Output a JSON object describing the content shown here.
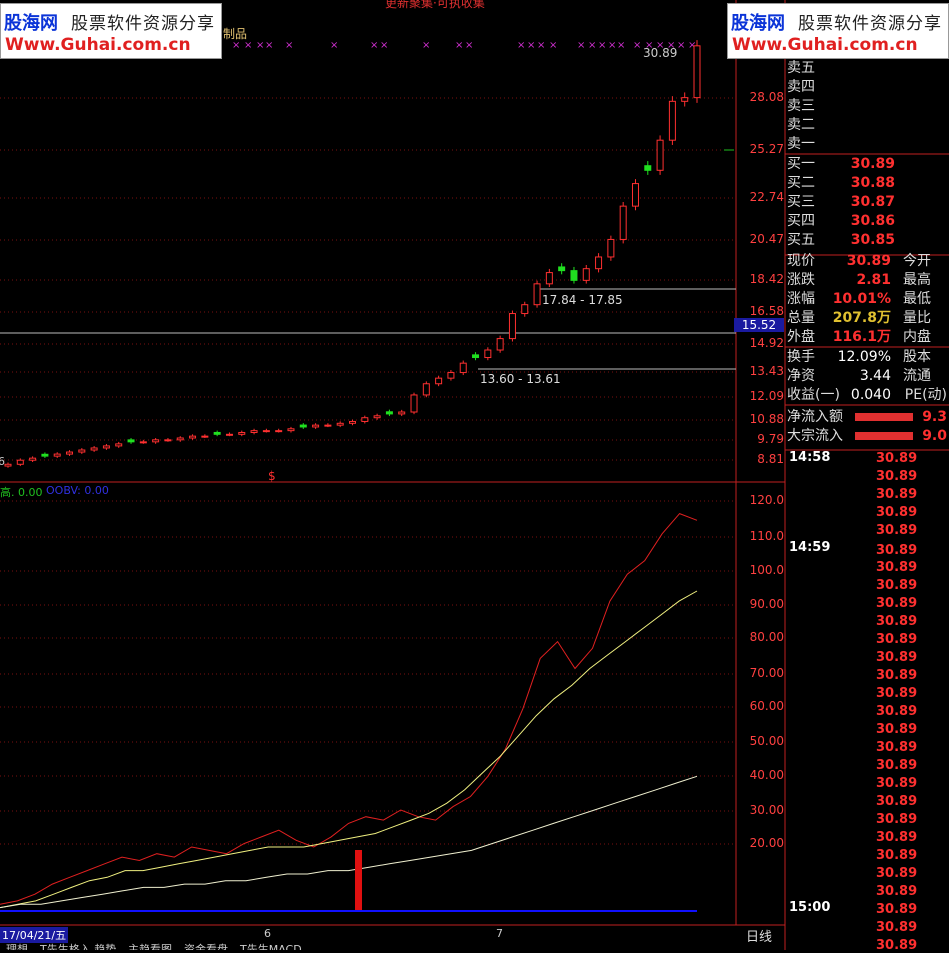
{
  "top_title": "更新聚集·可执收集",
  "watermark": {
    "brand": "股海网",
    "tagline": "股票软件资源分享",
    "url": "Www.Guhai.com.cn"
  },
  "indicator_title_fragment": "制品",
  "price_axis": [
    "28.08",
    "25.27",
    "22.74",
    "20.47",
    "18.42",
    "16.58",
    "14.92",
    "13.43",
    "12.09",
    "10.88",
    "9.79",
    "8.81"
  ],
  "current_price_marker": "15.52",
  "high_label": "30.89",
  "zone_labels": {
    "upper": "17.84 - 17.85",
    "lower": "13.60 - 13.61"
  },
  "dollar_marker": "$",
  "start_label": "6",
  "indicator_labels": {
    "left": "高. 0.00",
    "obv": "OOBV: 0.00"
  },
  "indicator_axis": [
    "120.0",
    "110.0",
    "100.0",
    "90.00",
    "80.00",
    "70.00",
    "60.00",
    "50.00",
    "40.00",
    "30.00",
    "20.00"
  ],
  "date_axis": {
    "start": "17/04/21/五",
    "m1": "6",
    "m2": "7",
    "period": "日线"
  },
  "bottom_tabs": [
    "理想",
    "T先生格入 趋势",
    "主趋看图",
    "资金看盘",
    "T先生MACD"
  ],
  "order_book": {
    "sells": [
      {
        "label": "卖五",
        "price": ""
      },
      {
        "label": "卖四",
        "price": ""
      },
      {
        "label": "卖三",
        "price": ""
      },
      {
        "label": "卖二",
        "price": ""
      },
      {
        "label": "卖一",
        "price": ""
      }
    ],
    "buys": [
      {
        "label": "买一",
        "price": "30.89"
      },
      {
        "label": "买二",
        "price": "30.88"
      },
      {
        "label": "买三",
        "price": "30.87"
      },
      {
        "label": "买四",
        "price": "30.86"
      },
      {
        "label": "买五",
        "price": "30.85"
      }
    ]
  },
  "stats": [
    {
      "l": "现价",
      "v": "30.89",
      "r": "今开"
    },
    {
      "l": "涨跌",
      "v": "2.81",
      "r": "最高"
    },
    {
      "l": "涨幅",
      "v": "10.01%",
      "r": "最低"
    },
    {
      "l": "总量",
      "v": "207.8万",
      "r": "量比"
    },
    {
      "l": "外盘",
      "v": "116.1万",
      "r": "内盘"
    }
  ],
  "stats2": [
    {
      "l": "换手",
      "v": "12.09%",
      "r": "股本"
    },
    {
      "l": "净资",
      "v": "3.44",
      "r": "流通"
    },
    {
      "l": "收益(一)",
      "v": "0.040",
      "r": "PE(动)"
    }
  ],
  "flows": [
    {
      "l": "净流入额",
      "v": "9.3"
    },
    {
      "l": "大宗流入",
      "v": "9.0"
    }
  ],
  "ticks": {
    "t1": "14:58",
    "t2": "14:59",
    "t3": "15:00",
    "price": "30.89"
  },
  "chart_data": {
    "type": "line",
    "title": "",
    "candles_close": [
      8.6,
      8.8,
      8.9,
      9.0,
      9.1,
      9.2,
      9.3,
      9.4,
      9.5,
      9.6,
      9.7,
      9.7,
      9.8,
      9.8,
      9.9,
      10.0,
      10.0,
      10.1,
      10.1,
      10.2,
      10.3,
      10.3,
      10.3,
      10.4,
      10.5,
      10.6,
      10.6,
      10.7,
      10.8,
      11.0,
      11.1,
      11.2,
      11.3,
      12.2,
      12.8,
      13.1,
      13.4,
      13.9,
      14.2,
      14.6,
      15.2,
      16.5,
      17.0,
      18.2,
      18.8,
      18.9,
      18.4,
      19.0,
      19.6,
      20.5,
      22.3,
      23.5,
      24.2,
      25.8,
      27.9,
      28.1,
      30.9
    ],
    "ylim": [
      8.6,
      31.0
    ],
    "indicator_series": [
      {
        "values": [
          2,
          3,
          5,
          8,
          10,
          12,
          14,
          16,
          15,
          17,
          16,
          19,
          18,
          17,
          20,
          22,
          24,
          21,
          19,
          22,
          26,
          28,
          27,
          30,
          28,
          27,
          31,
          34,
          40,
          48,
          60,
          75,
          80,
          72,
          78,
          92,
          100,
          104,
          112,
          118,
          116
        ]
      },
      {
        "values": [
          1,
          2,
          3,
          5,
          7,
          9,
          10,
          12,
          12,
          13,
          14,
          15,
          16,
          17,
          18,
          19,
          19,
          19,
          20,
          21,
          22,
          23,
          25,
          27,
          29,
          32,
          36,
          41,
          46,
          52,
          58,
          63,
          67,
          72,
          76,
          80,
          84,
          88,
          92,
          95
        ]
      },
      {
        "values": [
          1,
          2,
          2,
          3,
          4,
          5,
          6,
          7,
          7,
          8,
          8,
          9,
          9,
          10,
          11,
          11,
          12,
          12,
          13,
          14,
          15,
          16,
          17,
          18,
          20,
          22,
          24,
          26,
          28,
          30,
          32,
          34,
          36,
          38,
          40
        ]
      }
    ],
    "indicator_ylim": [
      0,
      125
    ]
  }
}
